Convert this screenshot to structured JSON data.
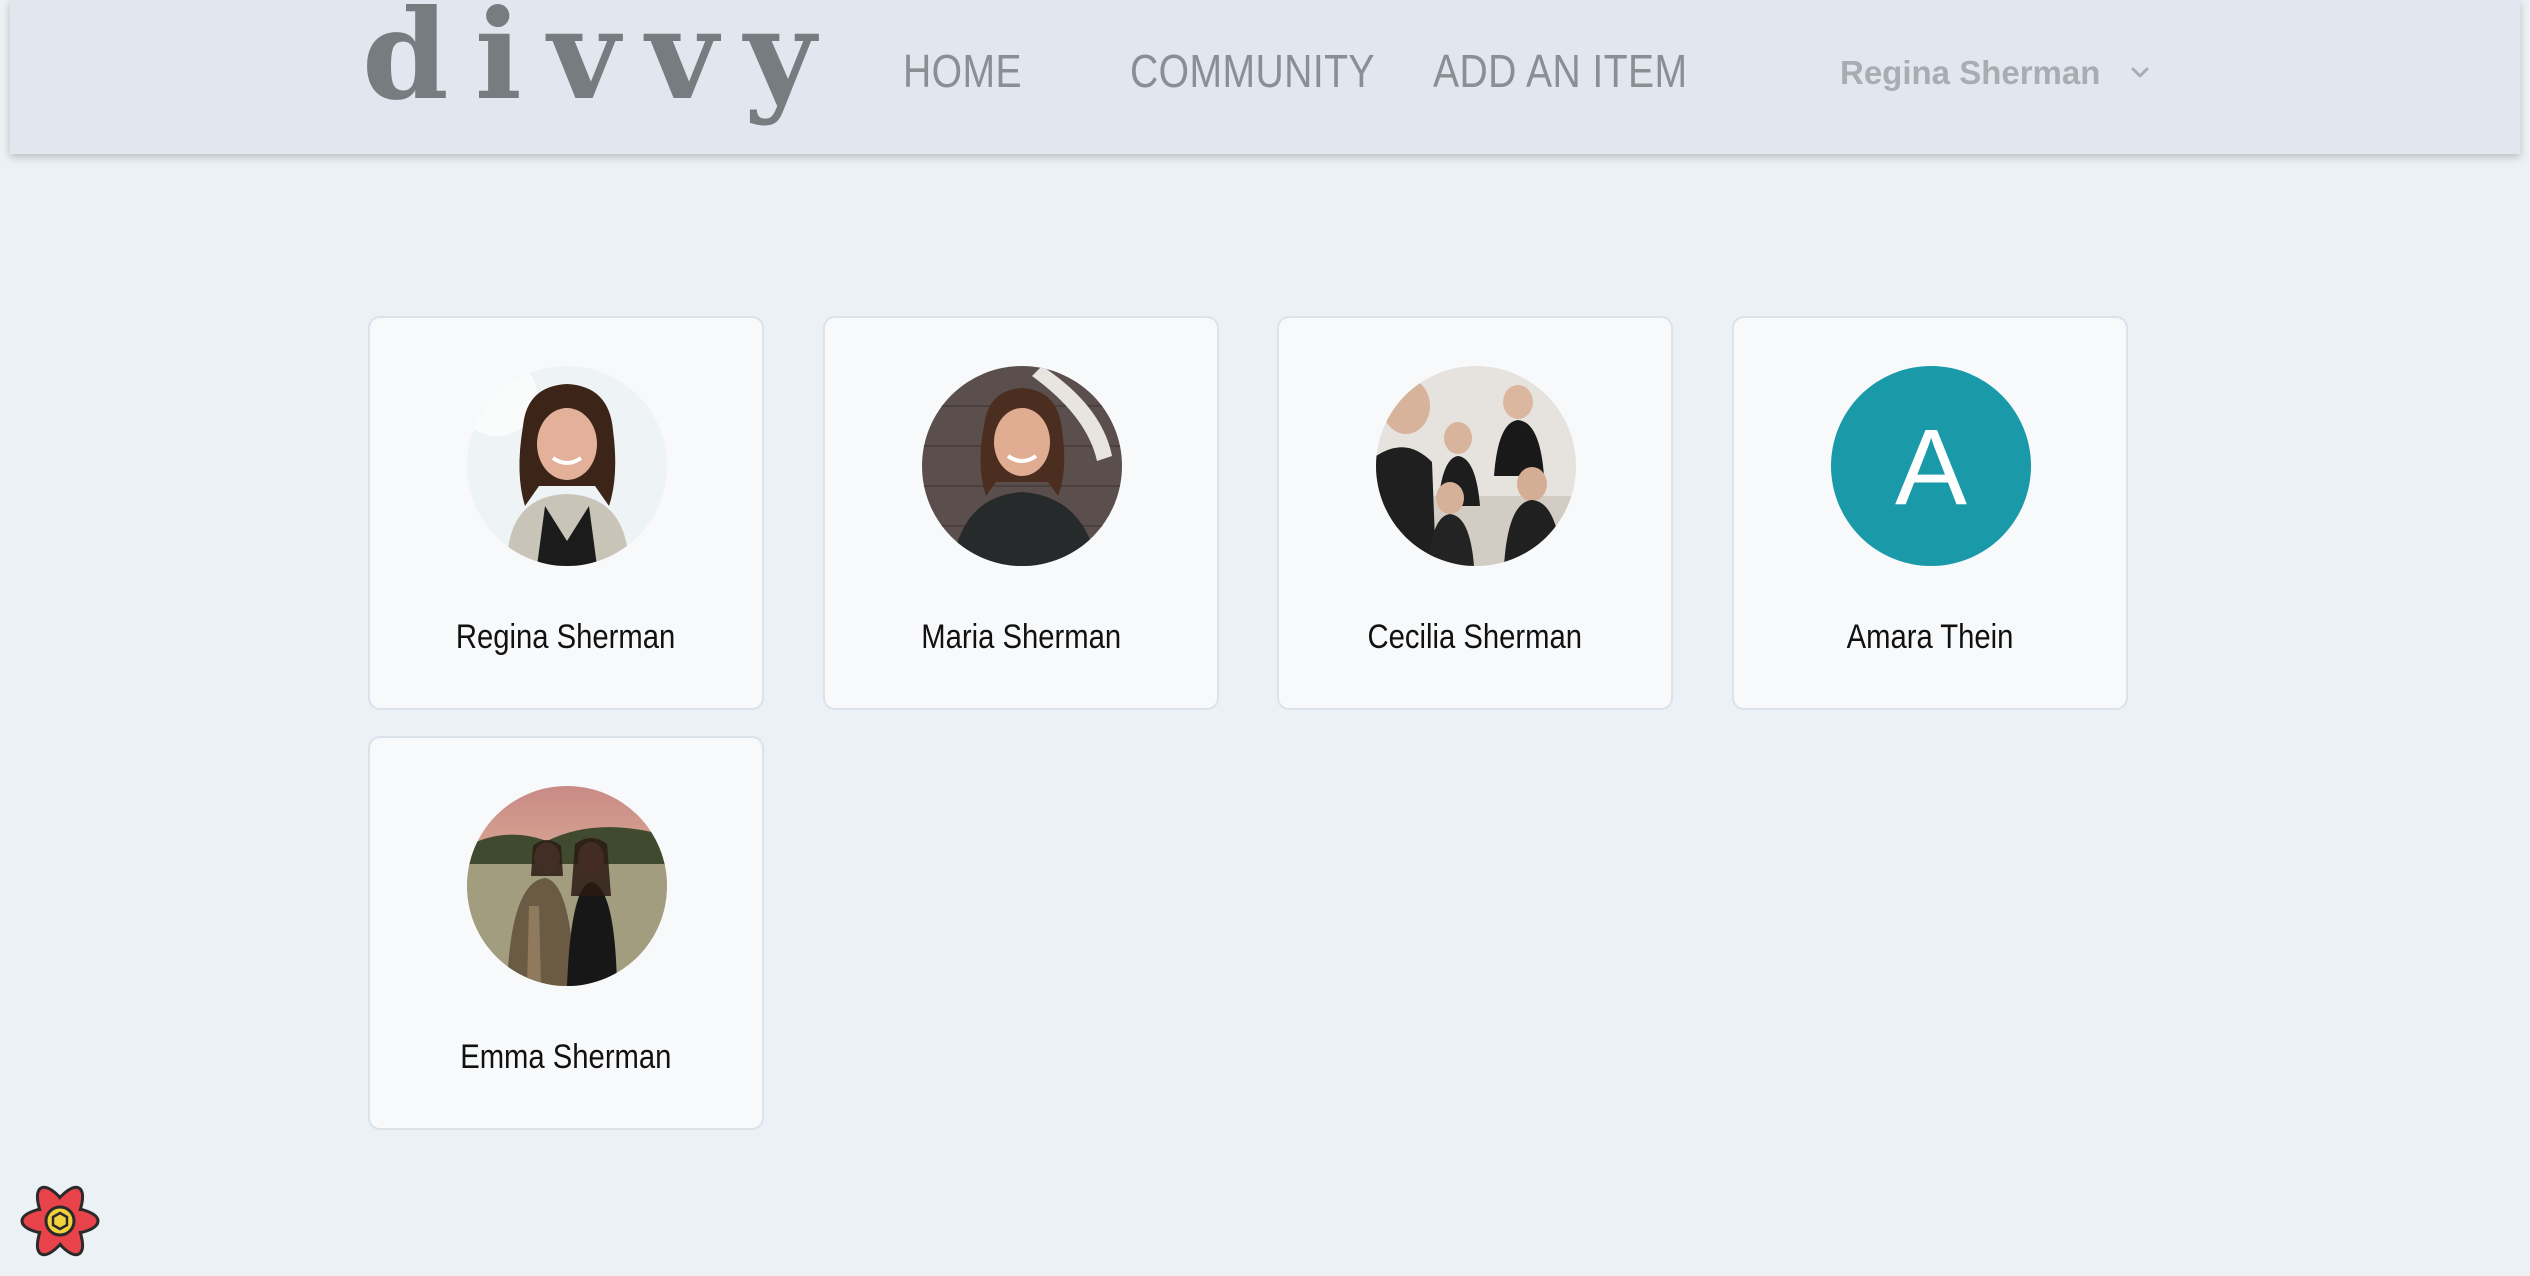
{
  "header": {
    "logo": "divvy",
    "nav": [
      "HOME",
      "COMMUNITY",
      "ADD AN ITEM"
    ],
    "user_name": "Regina Sherman",
    "user_menu_icon": "chevron-down-icon"
  },
  "members": [
    {
      "name": "Regina Sherman",
      "avatar": "photo"
    },
    {
      "name": "Maria Sherman",
      "avatar": "photo"
    },
    {
      "name": "Cecilia Sherman",
      "avatar": "photo"
    },
    {
      "name": "Amara Thein",
      "avatar": "letter",
      "letter": "A",
      "color": "#1a99a9"
    },
    {
      "name": "Emma Sherman",
      "avatar": "photo"
    }
  ],
  "devtools": {
    "icon": "react-devtools-icon"
  }
}
